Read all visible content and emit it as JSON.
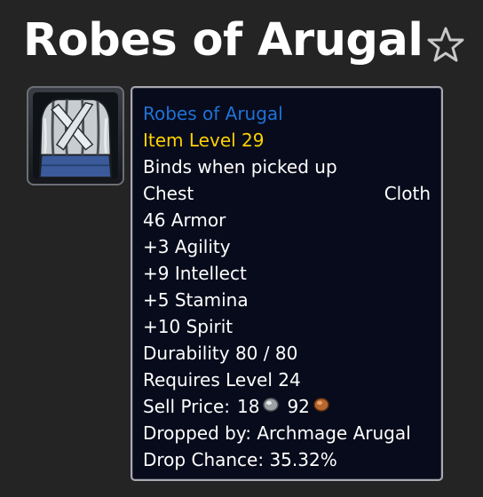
{
  "page": {
    "title": "Robes of Arugal",
    "favorite_icon": "star-outline-icon"
  },
  "item": {
    "icon": "robe-chest-icon",
    "name": "Robes of Arugal",
    "name_color": "#1f72d8",
    "item_level": "Item Level 29",
    "item_level_color": "#ffd100",
    "binding": "Binds when picked up",
    "slot": "Chest",
    "armor_type": "Cloth",
    "armor": "46 Armor",
    "stats": [
      "+3 Agility",
      "+9 Intellect",
      "+5 Stamina",
      "+10 Spirit"
    ],
    "durability": "Durability 80 / 80",
    "requires": "Requires Level 24",
    "sell_price_label": "Sell Price:",
    "sell_silver": "18",
    "sell_copper": "92",
    "silver_icon": "silver-coin-icon",
    "copper_icon": "copper-coin-icon",
    "dropped_by": "Dropped by: Archmage Arugal",
    "drop_chance": "Drop Chance: 35.32%"
  }
}
